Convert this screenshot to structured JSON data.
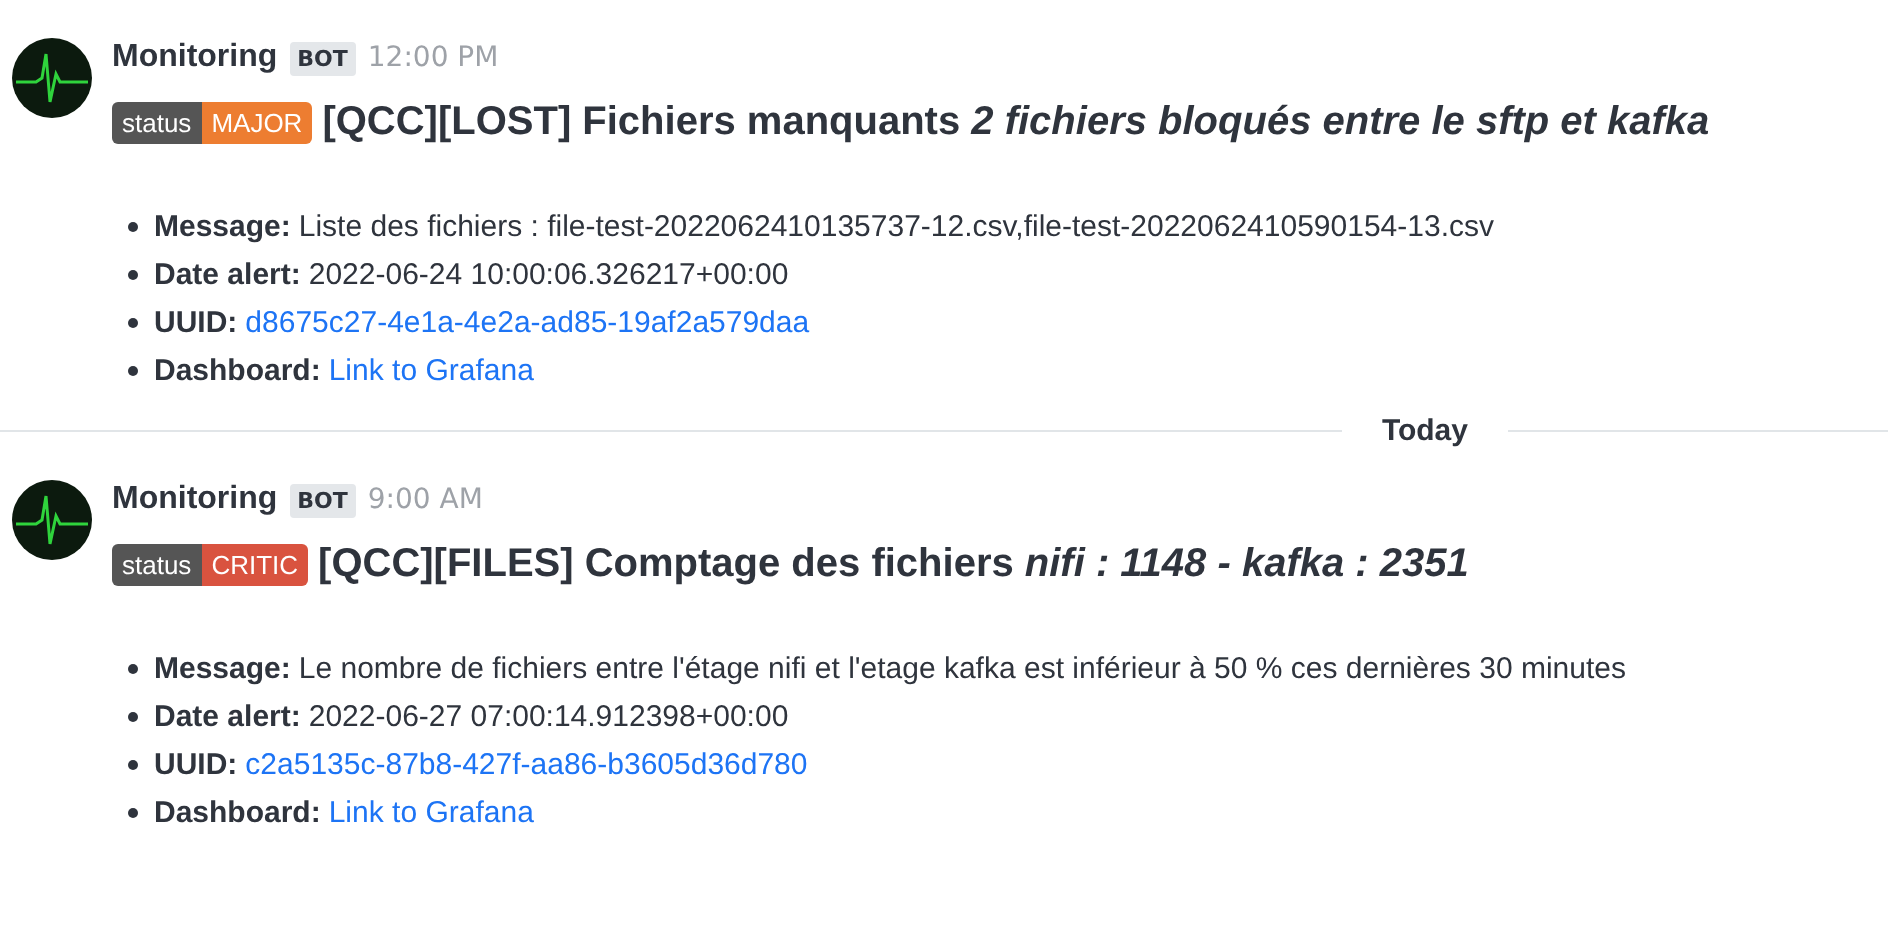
{
  "messages": [
    {
      "author": "Monitoring",
      "badge": "BOT",
      "time": "12:00 PM",
      "status_label": "status",
      "severity": {
        "label": "MAJOR",
        "color": "#ed7d31"
      },
      "title": "[QCC][LOST] Fichiers manquants *2 fichiers bloqués entre le sftp et kafka*",
      "fields": [
        {
          "kind": "text",
          "label": "Message:",
          "value": "Liste des fichiers : file-test-2022062410135737-12.csv,file-test-2022062410590154-13.csv"
        },
        {
          "kind": "text",
          "label": "Date alert:",
          "value": "2022-06-24 10:00:06.326217+00:00"
        },
        {
          "kind": "link",
          "label": "UUID:",
          "value": "d8675c27-4e1a-4e2a-ad85-19af2a579daa"
        },
        {
          "kind": "link",
          "label": "Dashboard:",
          "value": "Link to Grafana"
        }
      ]
    },
    {
      "divider": "Today",
      "author": "Monitoring",
      "badge": "BOT",
      "time": "9:00 AM",
      "status_label": "status",
      "severity": {
        "label": "CRITIC",
        "color": "#d9533f"
      },
      "title": "[QCC][FILES] Comptage des fichiers *nifi : 1148 - kafka : 2351*",
      "fields": [
        {
          "kind": "text",
          "label": "Message:",
          "value": "Le nombre de fichiers entre l'étage nifi et l'etage kafka est inférieur à 50 % ces dernières 30 minutes"
        },
        {
          "kind": "text",
          "label": "Date alert:",
          "value": "2022-06-27 07:00:14.912398+00:00"
        },
        {
          "kind": "link",
          "label": "UUID:",
          "value": "c2a5135c-87b8-427f-aa86-b3605d36d780"
        },
        {
          "kind": "link",
          "label": "Dashboard:",
          "value": "Link to Grafana"
        }
      ]
    }
  ]
}
